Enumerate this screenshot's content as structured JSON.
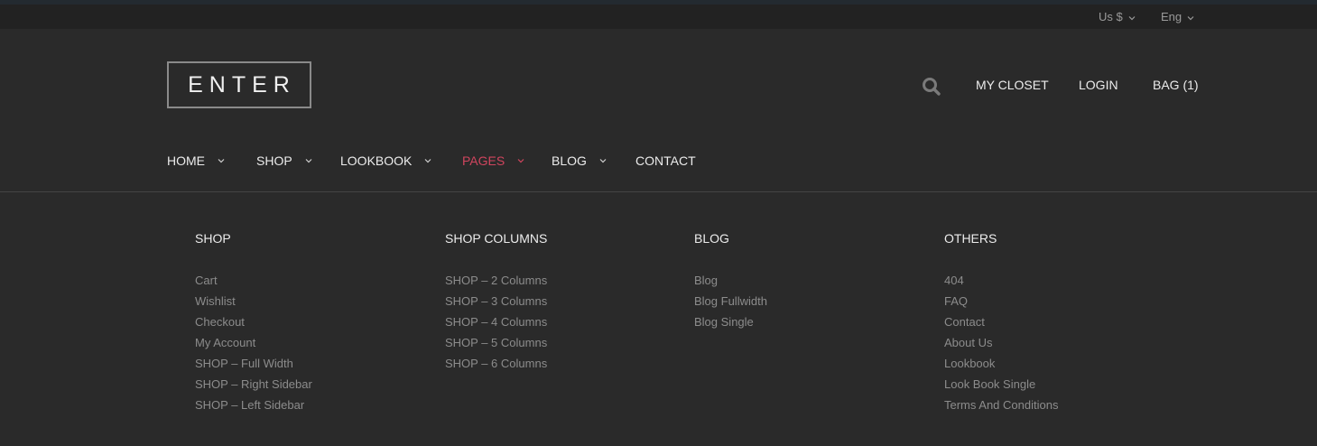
{
  "topbar": {
    "currency": "Us $",
    "language": "Eng"
  },
  "logo": "ENTER",
  "user_nav": {
    "my_closet": "MY CLOSET",
    "login": "LOGIN",
    "bag": "BAG (1)"
  },
  "main_nav": [
    {
      "label": "HOME",
      "has_dropdown": true,
      "active": false
    },
    {
      "label": "SHOP",
      "has_dropdown": true,
      "active": false
    },
    {
      "label": "LOOKBOOK",
      "has_dropdown": true,
      "active": false
    },
    {
      "label": "PAGES",
      "has_dropdown": true,
      "active": true
    },
    {
      "label": "BLOG",
      "has_dropdown": true,
      "active": false
    },
    {
      "label": "CONTACT",
      "has_dropdown": false,
      "active": false
    }
  ],
  "mega_menu": [
    {
      "heading": "SHOP",
      "links": [
        "Cart",
        "Wishlist",
        "Checkout",
        "My Account",
        "SHOP – Full Width",
        "SHOP – Right Sidebar",
        "SHOP – Left Sidebar"
      ]
    },
    {
      "heading": "SHOP COLUMNS",
      "links": [
        "SHOP – 2 Columns",
        "SHOP – 3 Columns",
        "SHOP – 4 Columns",
        "SHOP – 5 Columns",
        "SHOP – 6 Columns"
      ]
    },
    {
      "heading": "BLOG",
      "links": [
        "Blog",
        "Blog Fullwidth",
        "Blog Single"
      ]
    },
    {
      "heading": "OTHERS",
      "links": [
        "404",
        "FAQ",
        "Contact",
        "About Us",
        "Lookbook",
        "Look Book Single",
        "Terms And Conditions"
      ]
    }
  ],
  "colors": {
    "background": "#2a2a2a",
    "topbar": "#222222",
    "accent": "#d0455e",
    "link": "#8c8c8c"
  },
  "icons": [
    "search-icon",
    "chevron-down-icon"
  ]
}
